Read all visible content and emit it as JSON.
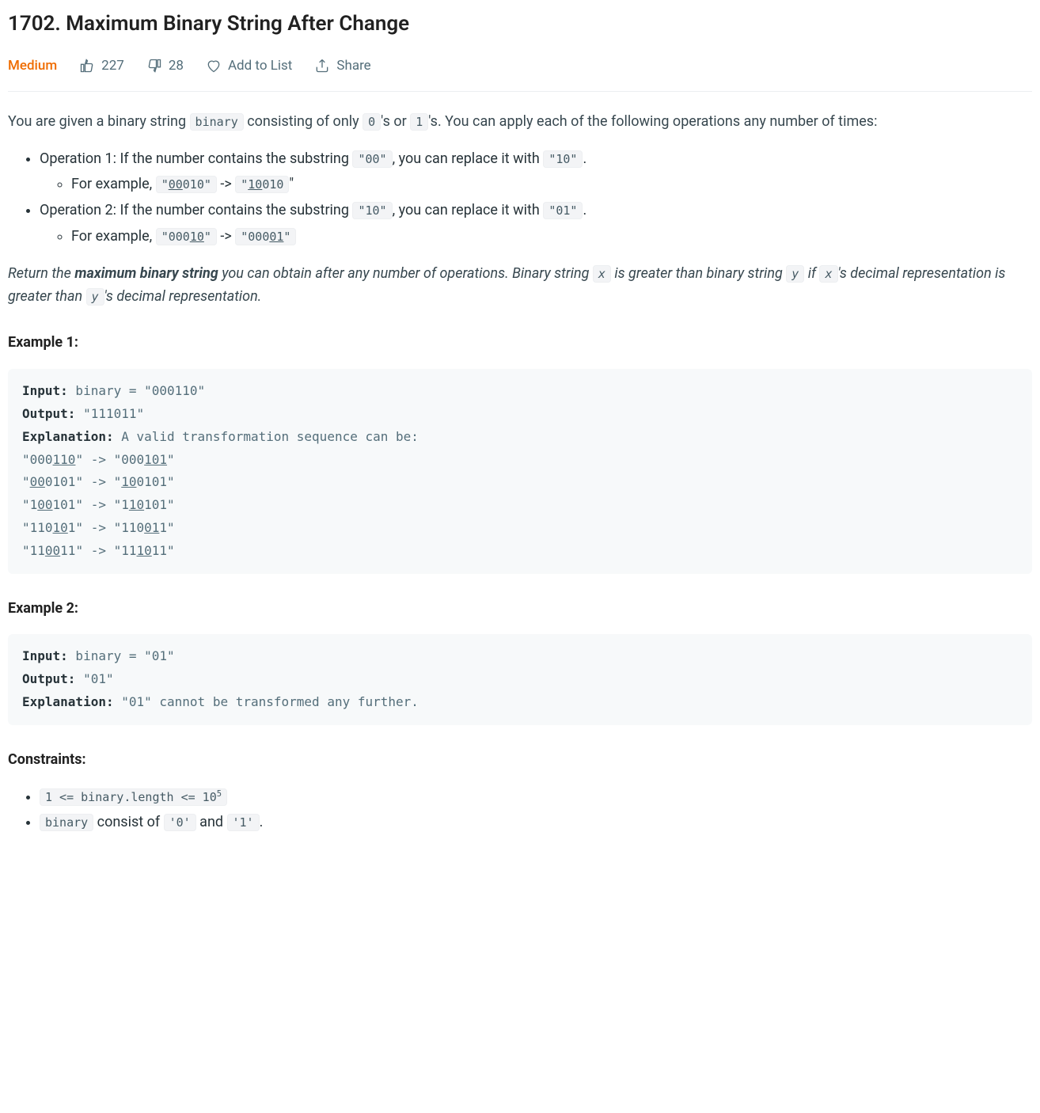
{
  "title": "1702. Maximum Binary String After Change",
  "difficulty": "Medium",
  "meta": {
    "likes": "227",
    "dislikes": "28",
    "add_to_list": "Add to List",
    "share": "Share"
  },
  "intro": {
    "p1a": "You are given a binary string ",
    "c1": "binary",
    "p1b": " consisting of only ",
    "c2": "0",
    "p1c": "'s or ",
    "c3": "1",
    "p1d": "'s. You can apply each of the following operations any number of times:"
  },
  "ops": {
    "op1a": "Operation 1: If the number contains the substring ",
    "op1c1": "\"00\"",
    "op1b": ", you can replace it with ",
    "op1c2": "\"10\"",
    "op1c": ".",
    "ex1a": "For example, ",
    "ex1arrow": " -> ",
    "ex1end": "\"",
    "op2a": "Operation 2: If the number contains the substring ",
    "op2c1": "\"10\"",
    "op2b": ", you can replace it with ",
    "op2c2": "\"01\"",
    "op2c": ".",
    "ex2a": "For example, ",
    "ex2arrow": " -> "
  },
  "return": {
    "a": "Return the ",
    "b": "maximum binary string",
    "c": " you can obtain after any number of operations. Binary string ",
    "d": "x",
    "e": " is greater than binary string ",
    "f": "y",
    "g": " if ",
    "h": "x",
    "i": "'s decimal representation is greater than ",
    "j": "y",
    "k": "'s decimal representation."
  },
  "ex1_header": "Example 1:",
  "ex1": {
    "input_label": "Input:",
    "input_val": " binary = \"000110\"",
    "output_label": "Output:",
    "output_val": " \"111011\"",
    "expl_label": "Explanation:",
    "expl_val": " A valid transformation sequence can be:"
  },
  "ex2_header": "Example 2:",
  "ex2": {
    "input_label": "Input:",
    "input_val": " binary = \"01\"",
    "output_label": "Output:",
    "output_val": " \"01\"",
    "expl_label": "Explanation:",
    "expl_val": " \"01\" cannot be transformed any further."
  },
  "constraints_header": "Constraints:",
  "constraints": {
    "c1a": "1 <= binary.length <= 10",
    "c1sup": "5",
    "c2a": "binary",
    "c2b": " consist of ",
    "c2c": "'0'",
    "c2d": " and ",
    "c2e": "'1'",
    "c2f": "."
  }
}
